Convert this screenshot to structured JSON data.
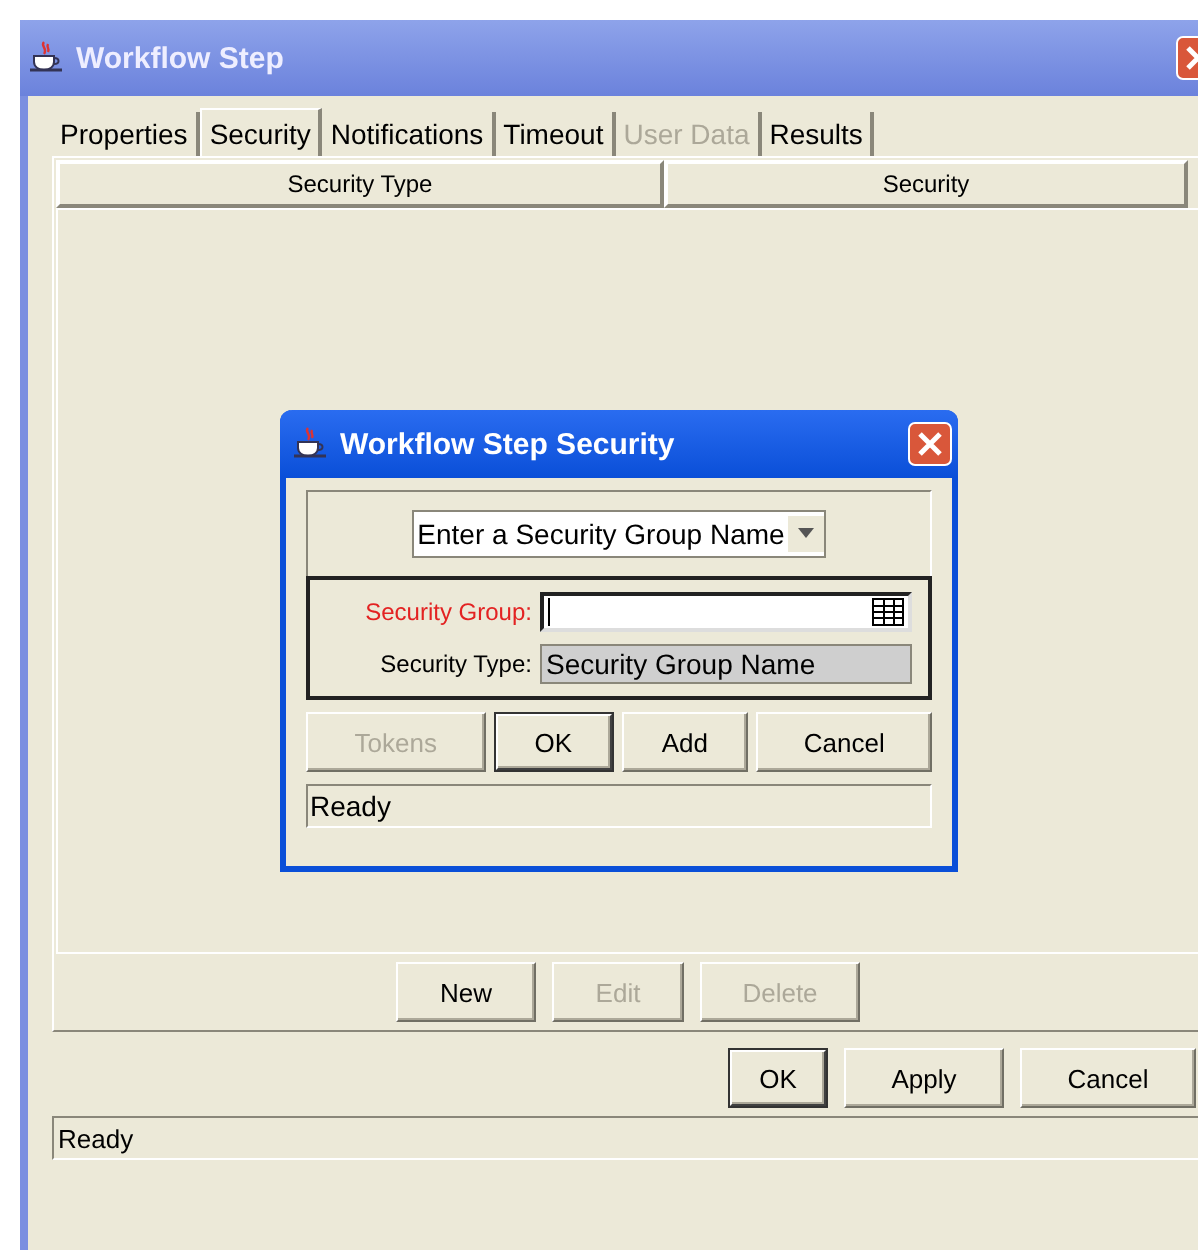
{
  "window": {
    "title": "Workflow Step"
  },
  "tabs": [
    {
      "label": "Properties",
      "selected": false,
      "disabled": false
    },
    {
      "label": "Security",
      "selected": true,
      "disabled": false
    },
    {
      "label": "Notifications",
      "selected": false,
      "disabled": false
    },
    {
      "label": "Timeout",
      "selected": false,
      "disabled": false
    },
    {
      "label": "User Data",
      "selected": false,
      "disabled": true
    },
    {
      "label": "Results",
      "selected": false,
      "disabled": false
    }
  ],
  "table": {
    "columns": [
      "Security Type",
      "Security"
    ]
  },
  "table_buttons": [
    {
      "label": "New",
      "disabled": false,
      "default": false
    },
    {
      "label": "Edit",
      "disabled": true,
      "default": false
    },
    {
      "label": "Delete",
      "disabled": true,
      "default": false
    }
  ],
  "window_buttons": [
    {
      "label": "OK",
      "disabled": false,
      "default": true
    },
    {
      "label": "Apply",
      "disabled": false,
      "default": false
    },
    {
      "label": "Cancel",
      "disabled": false,
      "default": false
    }
  ],
  "status_bar": "Ready",
  "dialog": {
    "title": "Workflow Step Security",
    "dropdown": {
      "value": "Enter a Security Group Name"
    },
    "fields": [
      {
        "kind": "lookup",
        "label": "Security Group:",
        "required": true
      },
      {
        "kind": "readonly",
        "label": "Security Type:",
        "value": "Security Group Name",
        "required": false
      }
    ],
    "buttons": [
      {
        "label": "Tokens",
        "disabled": true,
        "default": false
      },
      {
        "label": "OK",
        "disabled": false,
        "default": true
      },
      {
        "label": "Add",
        "disabled": false,
        "default": false
      },
      {
        "label": "Cancel",
        "disabled": false,
        "default": false
      }
    ],
    "status_bar": "Ready"
  }
}
